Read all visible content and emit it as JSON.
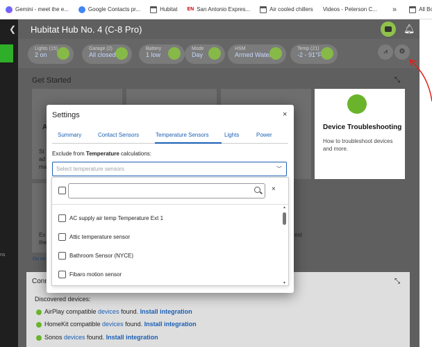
{
  "bookmarks": [
    {
      "label": "Gemini - meet the e...",
      "icon": "gemini-icon"
    },
    {
      "label": "Google Contacts pr...",
      "icon": "google-icon"
    },
    {
      "label": "Hubitat",
      "icon": "folder-icon"
    },
    {
      "label": "San Antonio Expres...",
      "icon": "ex-icon"
    },
    {
      "label": "Air cooled chillers",
      "icon": "folder-icon"
    },
    {
      "label": "Videos - Peterson C...",
      "icon": "none"
    }
  ],
  "bookmarks_more": "»",
  "all_bookmarks": "All Bookmarks",
  "header": {
    "title": "Hubitat Hub No. 4 (C-8 Pro)"
  },
  "tiles": [
    {
      "label": "Lights (15)",
      "value": "2 on"
    },
    {
      "label": "Garage (2)",
      "value": "All closed"
    },
    {
      "label": "Battery",
      "value": "1 low"
    },
    {
      "label": "Mode",
      "value": "Day"
    },
    {
      "label": "HSM",
      "value": "Armed Water"
    },
    {
      "label": "Temp (21)",
      "value": "-2 - 91°F"
    }
  ],
  "get_started": "Get Started",
  "device_troubleshooting": {
    "title": "Device Troubleshooting",
    "desc": "How to troubleshoot devices and more."
  },
  "partial_texts": {
    "a": "A",
    "st": "St",
    "ad": "ad",
    "ma": "ma",
    "ev": "Ev",
    "the": "the",
    "do_no": "Do no",
    "est": "est",
    "ns": "ns"
  },
  "connections": {
    "title": "Conn",
    "discovered": "Discovered devices:",
    "rows": [
      {
        "prefix": "AirPlay compatible ",
        "link": "devices",
        "mid": " found. ",
        "action": "Install integration"
      },
      {
        "prefix": "HomeKit compatible ",
        "link": "devices",
        "mid": " found. ",
        "action": "Install integration"
      },
      {
        "prefix": "Sonos ",
        "link": "devices",
        "mid": " found. ",
        "action": "Install integration"
      }
    ]
  },
  "modal": {
    "title": "Settings",
    "close": "×",
    "tabs": [
      "Summary",
      "Contact Sensors",
      "Temperature Sensors",
      "Lights",
      "Power"
    ],
    "active_tab": "Temperature Sensors",
    "exclude_prefix": "Exclude from ",
    "exclude_bold": "Temperature",
    "exclude_suffix": " calculations:",
    "select_placeholder": "Select temperature sensors",
    "clear": "×",
    "options": [
      "AC supply air temp Temperature Ext 1",
      "Attic temperature sensor",
      "Bathroom Sensor (NYCE)",
      "Fibaro motion sensor"
    ]
  },
  "colors": {
    "accent": "#1a5fb4",
    "hubitat_green": "#6ab42b",
    "annotation": "#e0201a"
  }
}
